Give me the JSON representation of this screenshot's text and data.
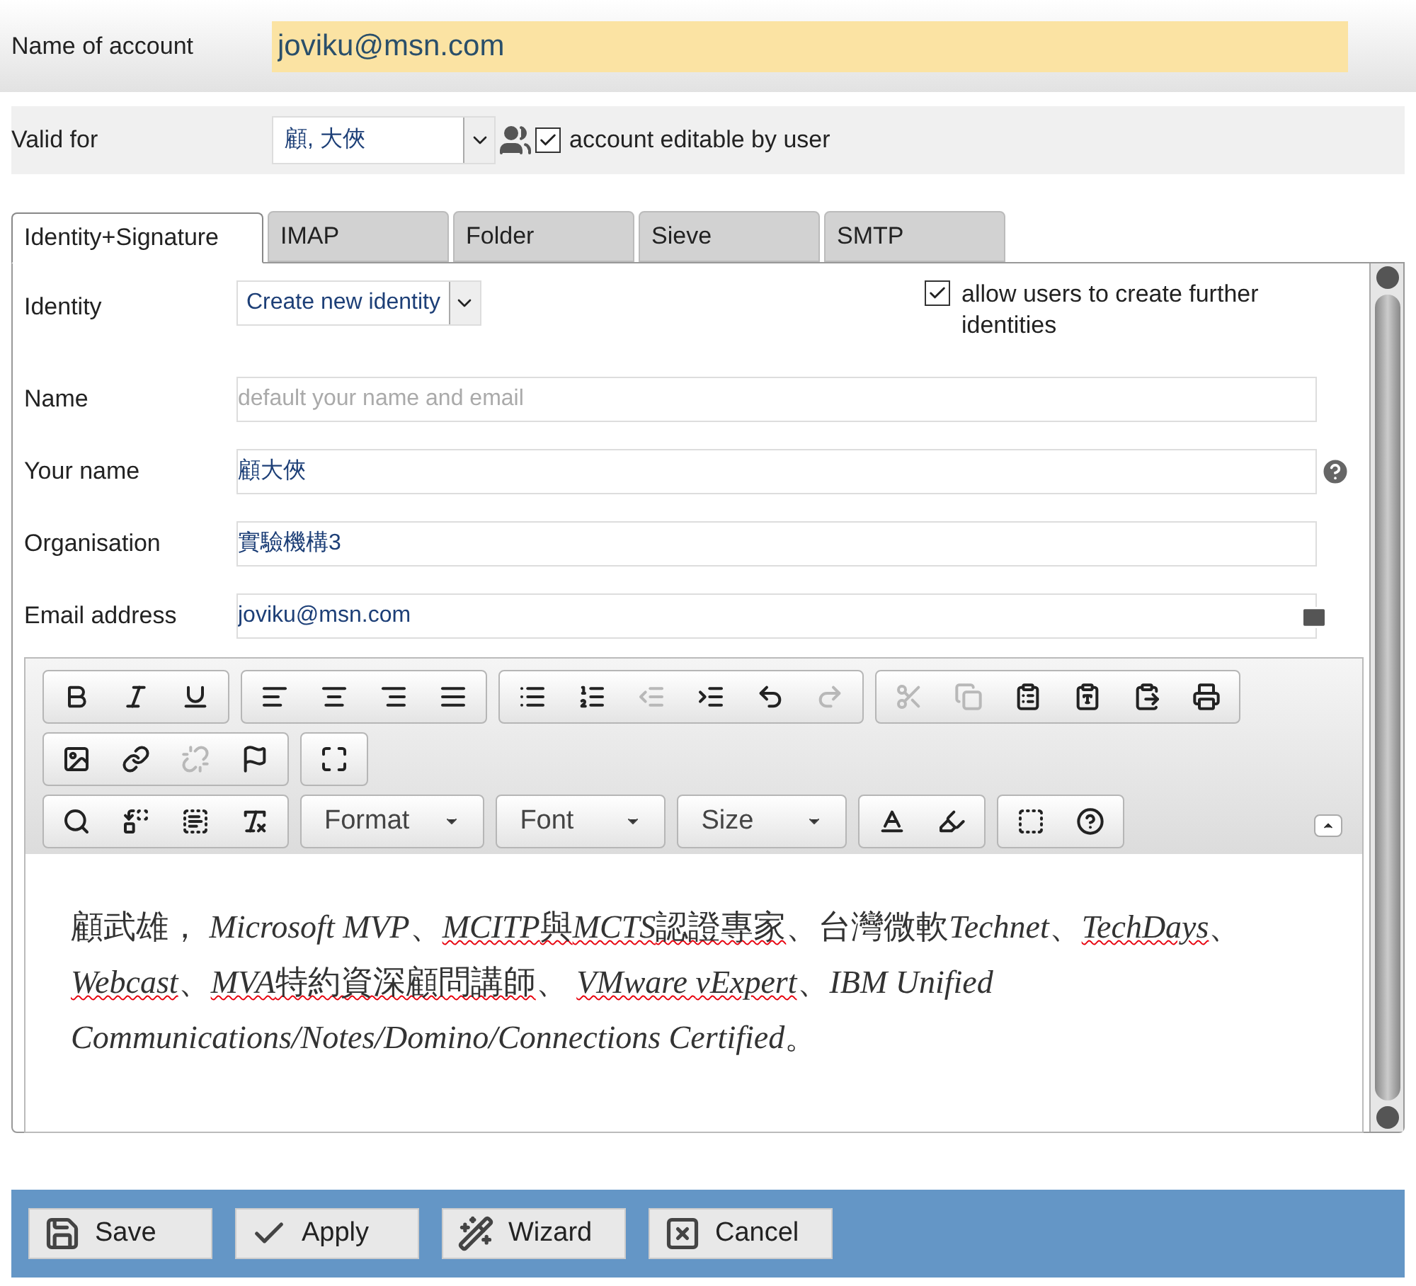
{
  "account": {
    "label": "Name of account",
    "value": "joviku@msn.com"
  },
  "valid_for": {
    "label": "Valid for",
    "value": "顧, 大俠",
    "editable_checkbox": {
      "label": "account editable by user",
      "checked": true
    }
  },
  "tabs": [
    {
      "label": "Identity+Signature",
      "selected": true
    },
    {
      "label": "IMAP",
      "selected": false
    },
    {
      "label": "Folder",
      "selected": false
    },
    {
      "label": "Sieve",
      "selected": false
    },
    {
      "label": "SMTP",
      "selected": false
    }
  ],
  "identity": {
    "label": "Identity",
    "value": "Create new identity",
    "further_checkbox": {
      "label": "allow users to create further identities",
      "checked": true
    }
  },
  "fields": [
    {
      "label": "Name",
      "placeholder": "default your name and email",
      "kind": "plain"
    },
    {
      "label": "Your name",
      "value": "顧大俠",
      "kind": "help"
    },
    {
      "label": "Organisation",
      "value": "實驗機構3",
      "kind": "plain"
    },
    {
      "label": "Email address",
      "value": "joviku@msn.com",
      "kind": "mail"
    }
  ],
  "toolbar_rows": [
    [
      [
        {
          "kind": "bold",
          "disabled": false
        },
        {
          "kind": "italic",
          "disabled": false
        },
        {
          "kind": "underline",
          "disabled": false
        }
      ],
      [
        {
          "kind": "align-left",
          "disabled": false
        },
        {
          "kind": "align-center",
          "disabled": false
        },
        {
          "kind": "align-right",
          "disabled": false
        },
        {
          "kind": "justify",
          "disabled": false
        }
      ],
      [
        {
          "kind": "bullets",
          "disabled": false
        },
        {
          "kind": "numbers",
          "disabled": false
        },
        {
          "kind": "outdent",
          "disabled": true
        },
        {
          "kind": "indent",
          "disabled": false
        },
        {
          "kind": "undo",
          "disabled": false
        },
        {
          "kind": "redo",
          "disabled": true
        }
      ],
      [
        {
          "kind": "cut",
          "disabled": true
        },
        {
          "kind": "copy",
          "disabled": true
        },
        {
          "kind": "paste",
          "disabled": false
        },
        {
          "kind": "paste-text",
          "disabled": false
        },
        {
          "kind": "paste-word",
          "disabled": false
        },
        {
          "kind": "print",
          "disabled": false
        }
      ]
    ],
    [
      [
        {
          "kind": "image",
          "disabled": false
        },
        {
          "kind": "link",
          "disabled": false
        },
        {
          "kind": "unlink",
          "disabled": true
        },
        {
          "kind": "anchor",
          "disabled": false
        }
      ],
      [
        {
          "kind": "maximize",
          "disabled": false
        }
      ]
    ],
    [
      [
        {
          "kind": "find",
          "disabled": false
        },
        {
          "kind": "replace",
          "disabled": false
        },
        {
          "kind": "select-all",
          "disabled": false
        },
        {
          "kind": "clear-format",
          "disabled": false
        }
      ],
      [
        {
          "kind": "dropdown",
          "label": "Format"
        },
        {
          "kind": "dropdown",
          "label": "Font"
        },
        {
          "kind": "dropdown",
          "label": "Size"
        }
      ],
      [
        {
          "kind": "text-color",
          "disabled": false
        },
        {
          "kind": "bg-color",
          "disabled": false
        }
      ],
      [
        {
          "kind": "blocks",
          "disabled": false
        },
        {
          "kind": "help",
          "disabled": false
        }
      ]
    ]
  ],
  "editor_text": [
    {
      "text": "顧武雄， ",
      "italic": false,
      "misspelled": false
    },
    {
      "text": "Microsoft MVP",
      "italic": true,
      "misspelled": false
    },
    {
      "text": "、",
      "italic": false,
      "misspelled": false
    },
    {
      "text": "MCITP",
      "italic": true,
      "misspelled": true
    },
    {
      "text": "與",
      "italic": false,
      "misspelled": true
    },
    {
      "text": "MCTS",
      "italic": true,
      "misspelled": true
    },
    {
      "text": "認證專家",
      "italic": false,
      "misspelled": true
    },
    {
      "text": "、台灣微軟",
      "italic": false,
      "misspelled": false
    },
    {
      "text": "Technet",
      "italic": true,
      "misspelled": false
    },
    {
      "text": "、",
      "italic": false,
      "misspelled": false
    },
    {
      "text": "TechDays",
      "italic": true,
      "misspelled": true
    },
    {
      "text": "、 ",
      "italic": false,
      "misspelled": false
    },
    {
      "text": "Webcast",
      "italic": true,
      "misspelled": true
    },
    {
      "text": "、",
      "italic": false,
      "misspelled": false
    },
    {
      "text": "MVA",
      "italic": true,
      "misspelled": true
    },
    {
      "text": "特約資深顧問講師",
      "italic": false,
      "misspelled": true
    },
    {
      "text": "、 ",
      "italic": false,
      "misspelled": false
    },
    {
      "text": "VMware ",
      "italic": true,
      "misspelled": true
    },
    {
      "text": "vExpert",
      "italic": true,
      "misspelled": true
    },
    {
      "text": "、",
      "italic": false,
      "misspelled": false
    },
    {
      "text": "IBM Unified Communications/Notes/Domino/Connections Certified",
      "italic": true,
      "misspelled": false
    },
    {
      "text": "。",
      "italic": false,
      "misspelled": false
    }
  ],
  "footer_buttons": [
    {
      "label": "Save",
      "kind": "save"
    },
    {
      "label": "Apply",
      "kind": "apply"
    },
    {
      "label": "Wizard",
      "kind": "wizard"
    },
    {
      "label": "Cancel",
      "kind": "cancel"
    }
  ]
}
